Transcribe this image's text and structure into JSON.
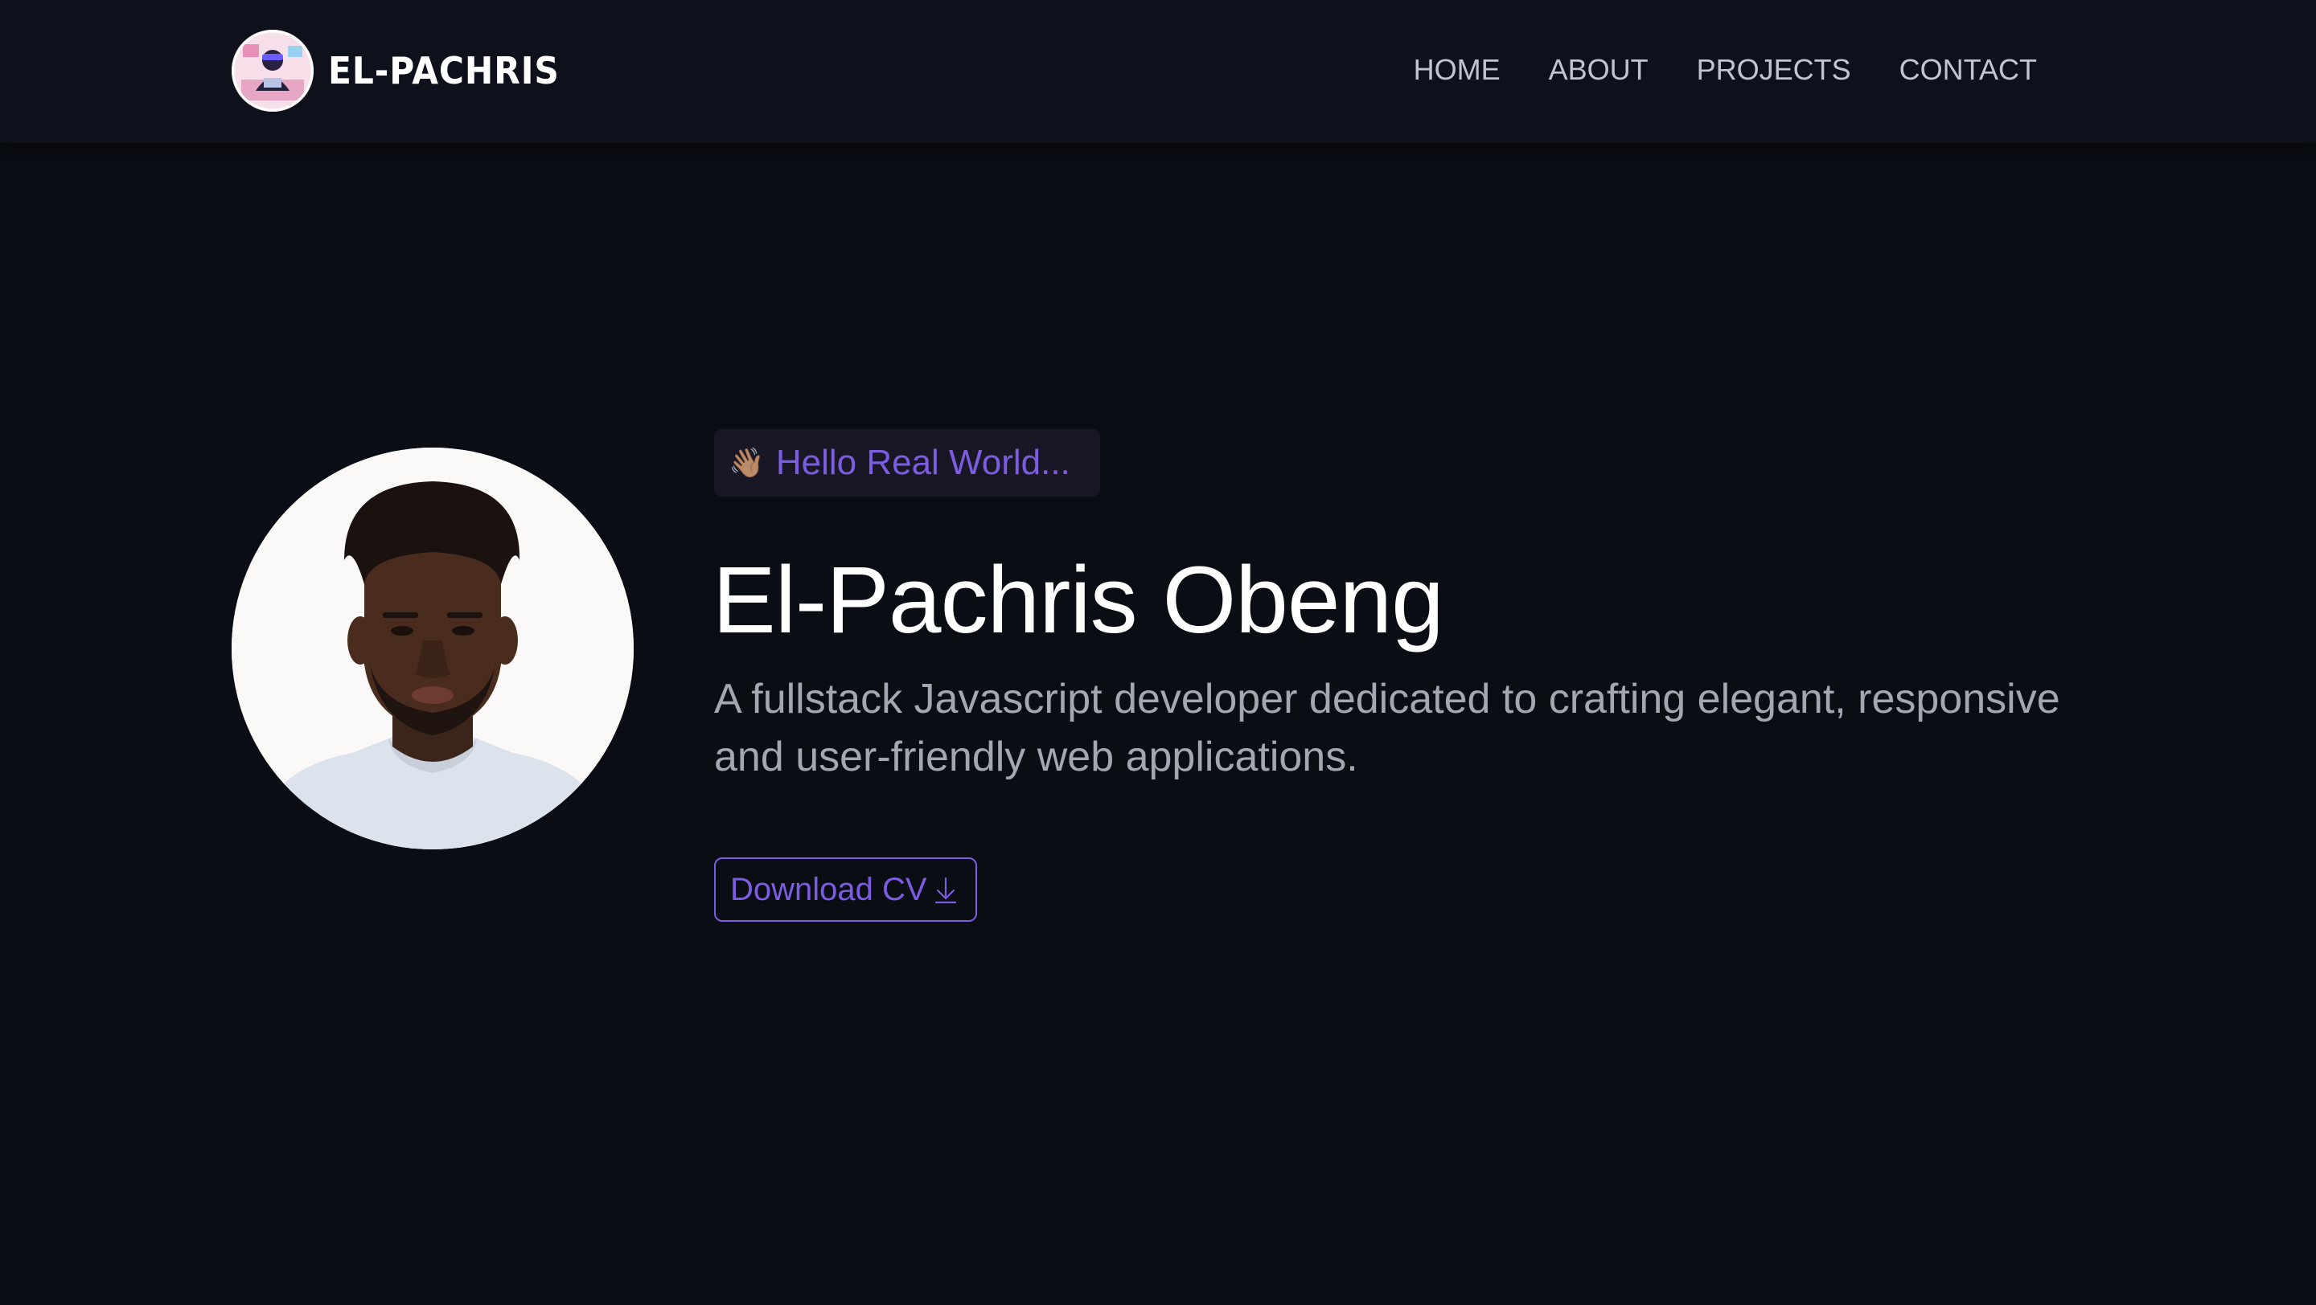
{
  "header": {
    "brand_name": "EL-PACHRIS",
    "logo_icon": "avatar-logo-icon",
    "nav": [
      {
        "label": "HOME"
      },
      {
        "label": "ABOUT"
      },
      {
        "label": "PROJECTS"
      },
      {
        "label": "CONTACT"
      }
    ]
  },
  "hero": {
    "greeting_icon": "waving-hand-icon",
    "greeting_emoji": "👋🏽",
    "greeting": "Hello Real World...",
    "name": "El-Pachris Obeng",
    "tagline": "A fullstack Javascript developer dedicated to crafting elegant, responsive and user-friendly web applications.",
    "cta_label": "Download CV",
    "cta_icon": "download-arrow-icon"
  },
  "colors": {
    "background": "#0a0d14",
    "header_background": "#0e111b",
    "accent": "#7c5ce0",
    "text_primary": "#ffffff",
    "text_secondary": "#a4a7b1",
    "nav_text": "#c2c5cf"
  }
}
